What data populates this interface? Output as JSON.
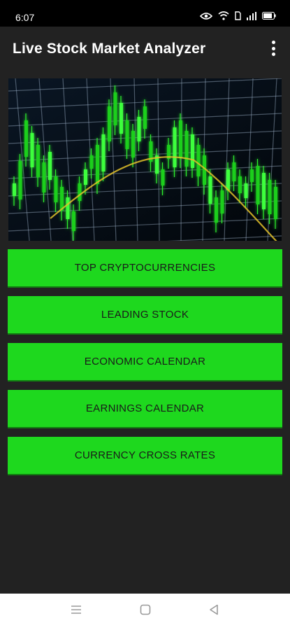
{
  "status_bar": {
    "time": "6:07",
    "battery_level": 0.8
  },
  "app_bar": {
    "title": "Live Stock Market Analyzer"
  },
  "menu": [
    {
      "label": "TOP CRYPTOCURRENCIES"
    },
    {
      "label": "LEADING STOCK"
    },
    {
      "label": "ECONOMIC CALENDAR"
    },
    {
      "label": "EARNINGS CALENDAR"
    },
    {
      "label": "CURRENCY CROSS RATES"
    }
  ],
  "colors": {
    "background": "#222222",
    "button_green": "#1ed81e",
    "button_text": "#1a1a1a"
  },
  "icons": [
    "eye-icon",
    "wifi-icon",
    "sim-icon",
    "signal-icon",
    "battery-icon",
    "more-vert-icon",
    "recents-icon",
    "home-icon",
    "back-icon"
  ]
}
